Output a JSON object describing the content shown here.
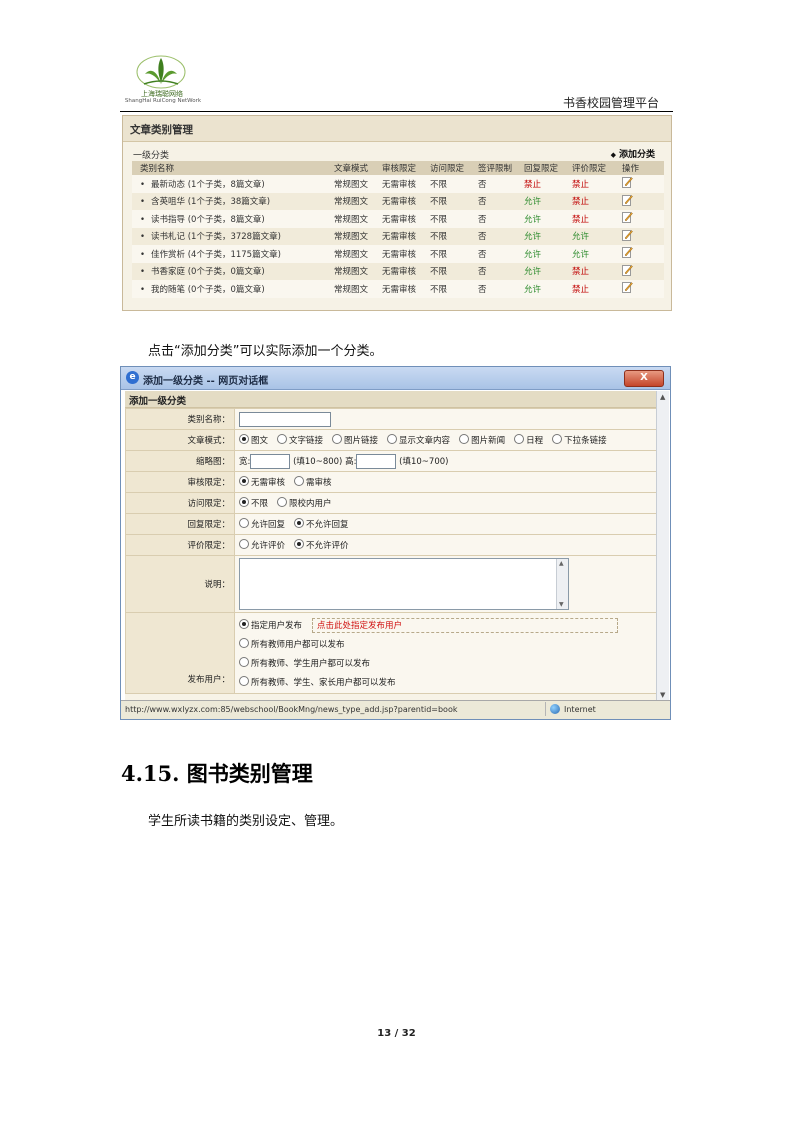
{
  "header": {
    "logo_cn": "上海瑞聪网络",
    "logo_en": "ShangHai RuiCong NetWork",
    "title": "书香校园管理平台"
  },
  "category_panel": {
    "title": "文章类别管理",
    "subtitle": "一级分类",
    "add_label": "添加分类",
    "columns": [
      "类别名称",
      "文章模式",
      "审核限定",
      "访问限定",
      "签评限制",
      "回复限定",
      "评价限定",
      "操作"
    ],
    "rows": [
      {
        "name": "最新动态 (1个子类，8篇文章)",
        "mode": "常规图文",
        "audit": "无需审核",
        "access": "不限",
        "sign": "否",
        "reply": "禁止",
        "rating": "禁止"
      },
      {
        "name": "含英咀华 (1个子类，38篇文章)",
        "mode": "常规图文",
        "audit": "无需审核",
        "access": "不限",
        "sign": "否",
        "reply": "允许",
        "rating": "禁止"
      },
      {
        "name": "读书指导 (0个子类，8篇文章)",
        "mode": "常规图文",
        "audit": "无需审核",
        "access": "不限",
        "sign": "否",
        "reply": "允许",
        "rating": "禁止"
      },
      {
        "name": "读书札记 (1个子类，3728篇文章)",
        "mode": "常规图文",
        "audit": "无需审核",
        "access": "不限",
        "sign": "否",
        "reply": "允许",
        "rating": "允许"
      },
      {
        "name": "佳作赏析 (4个子类，1175篇文章)",
        "mode": "常规图文",
        "audit": "无需审核",
        "access": "不限",
        "sign": "否",
        "reply": "允许",
        "rating": "允许"
      },
      {
        "name": "书香家庭 (0个子类，0篇文章)",
        "mode": "常规图文",
        "audit": "无需审核",
        "access": "不限",
        "sign": "否",
        "reply": "允许",
        "rating": "禁止"
      },
      {
        "name": "我的随笔 (0个子类，0篇文章)",
        "mode": "常规图文",
        "audit": "无需审核",
        "access": "不限",
        "sign": "否",
        "reply": "允许",
        "rating": "禁止"
      }
    ],
    "colors": {
      "allow": "#2a8a2a",
      "deny": "#c00000"
    }
  },
  "paragraph1": "点击“添加分类”可以实际添加一个分类。",
  "dialog": {
    "title": "添加一级分类 -- 网页对话框",
    "close_label": "X",
    "section_title": "添加一级分类",
    "fields": {
      "name_label": "类别名称：",
      "mode_label": "文章模式：",
      "mode_options": [
        "图文",
        "文字链接",
        "图片链接",
        "显示文章内容",
        "图片新闻",
        "日程",
        "下拉条链接"
      ],
      "thumb_label": "缩略图：",
      "thumb_width_label": "宽:",
      "thumb_width_hint": "(填10~800)",
      "thumb_height_label": "高:",
      "thumb_height_hint": "(填10~700)",
      "audit_label": "审核限定：",
      "audit_options": [
        "无需审核",
        "需审核"
      ],
      "access_label": "访问限定：",
      "access_options": [
        "不限",
        "限校内用户"
      ],
      "reply_label": "回复限定：",
      "reply_options": [
        "允许回复",
        "不允许回复"
      ],
      "rating_label": "评价限定：",
      "rating_options": [
        "允许评价",
        "不允许评价"
      ],
      "desc_label": "说明：",
      "publisher_label": "发布用户：",
      "publisher_options": [
        "指定用户发布",
        "所有教师用户都可以发布",
        "所有教师、学生用户都可以发布",
        "所有教师、学生、家长用户都可以发布"
      ],
      "publisher_hint": "点击此处指定发布用户"
    },
    "status_url": "http://www.wxlyzx.com:85/webschool/BookMng/news_type_add.jsp?parentid=book",
    "status_zone": "Internet"
  },
  "section_heading": "4.15. 图书类别管理",
  "paragraph2": "学生所读书籍的类别设定、管理。",
  "footer": "13 / 32"
}
